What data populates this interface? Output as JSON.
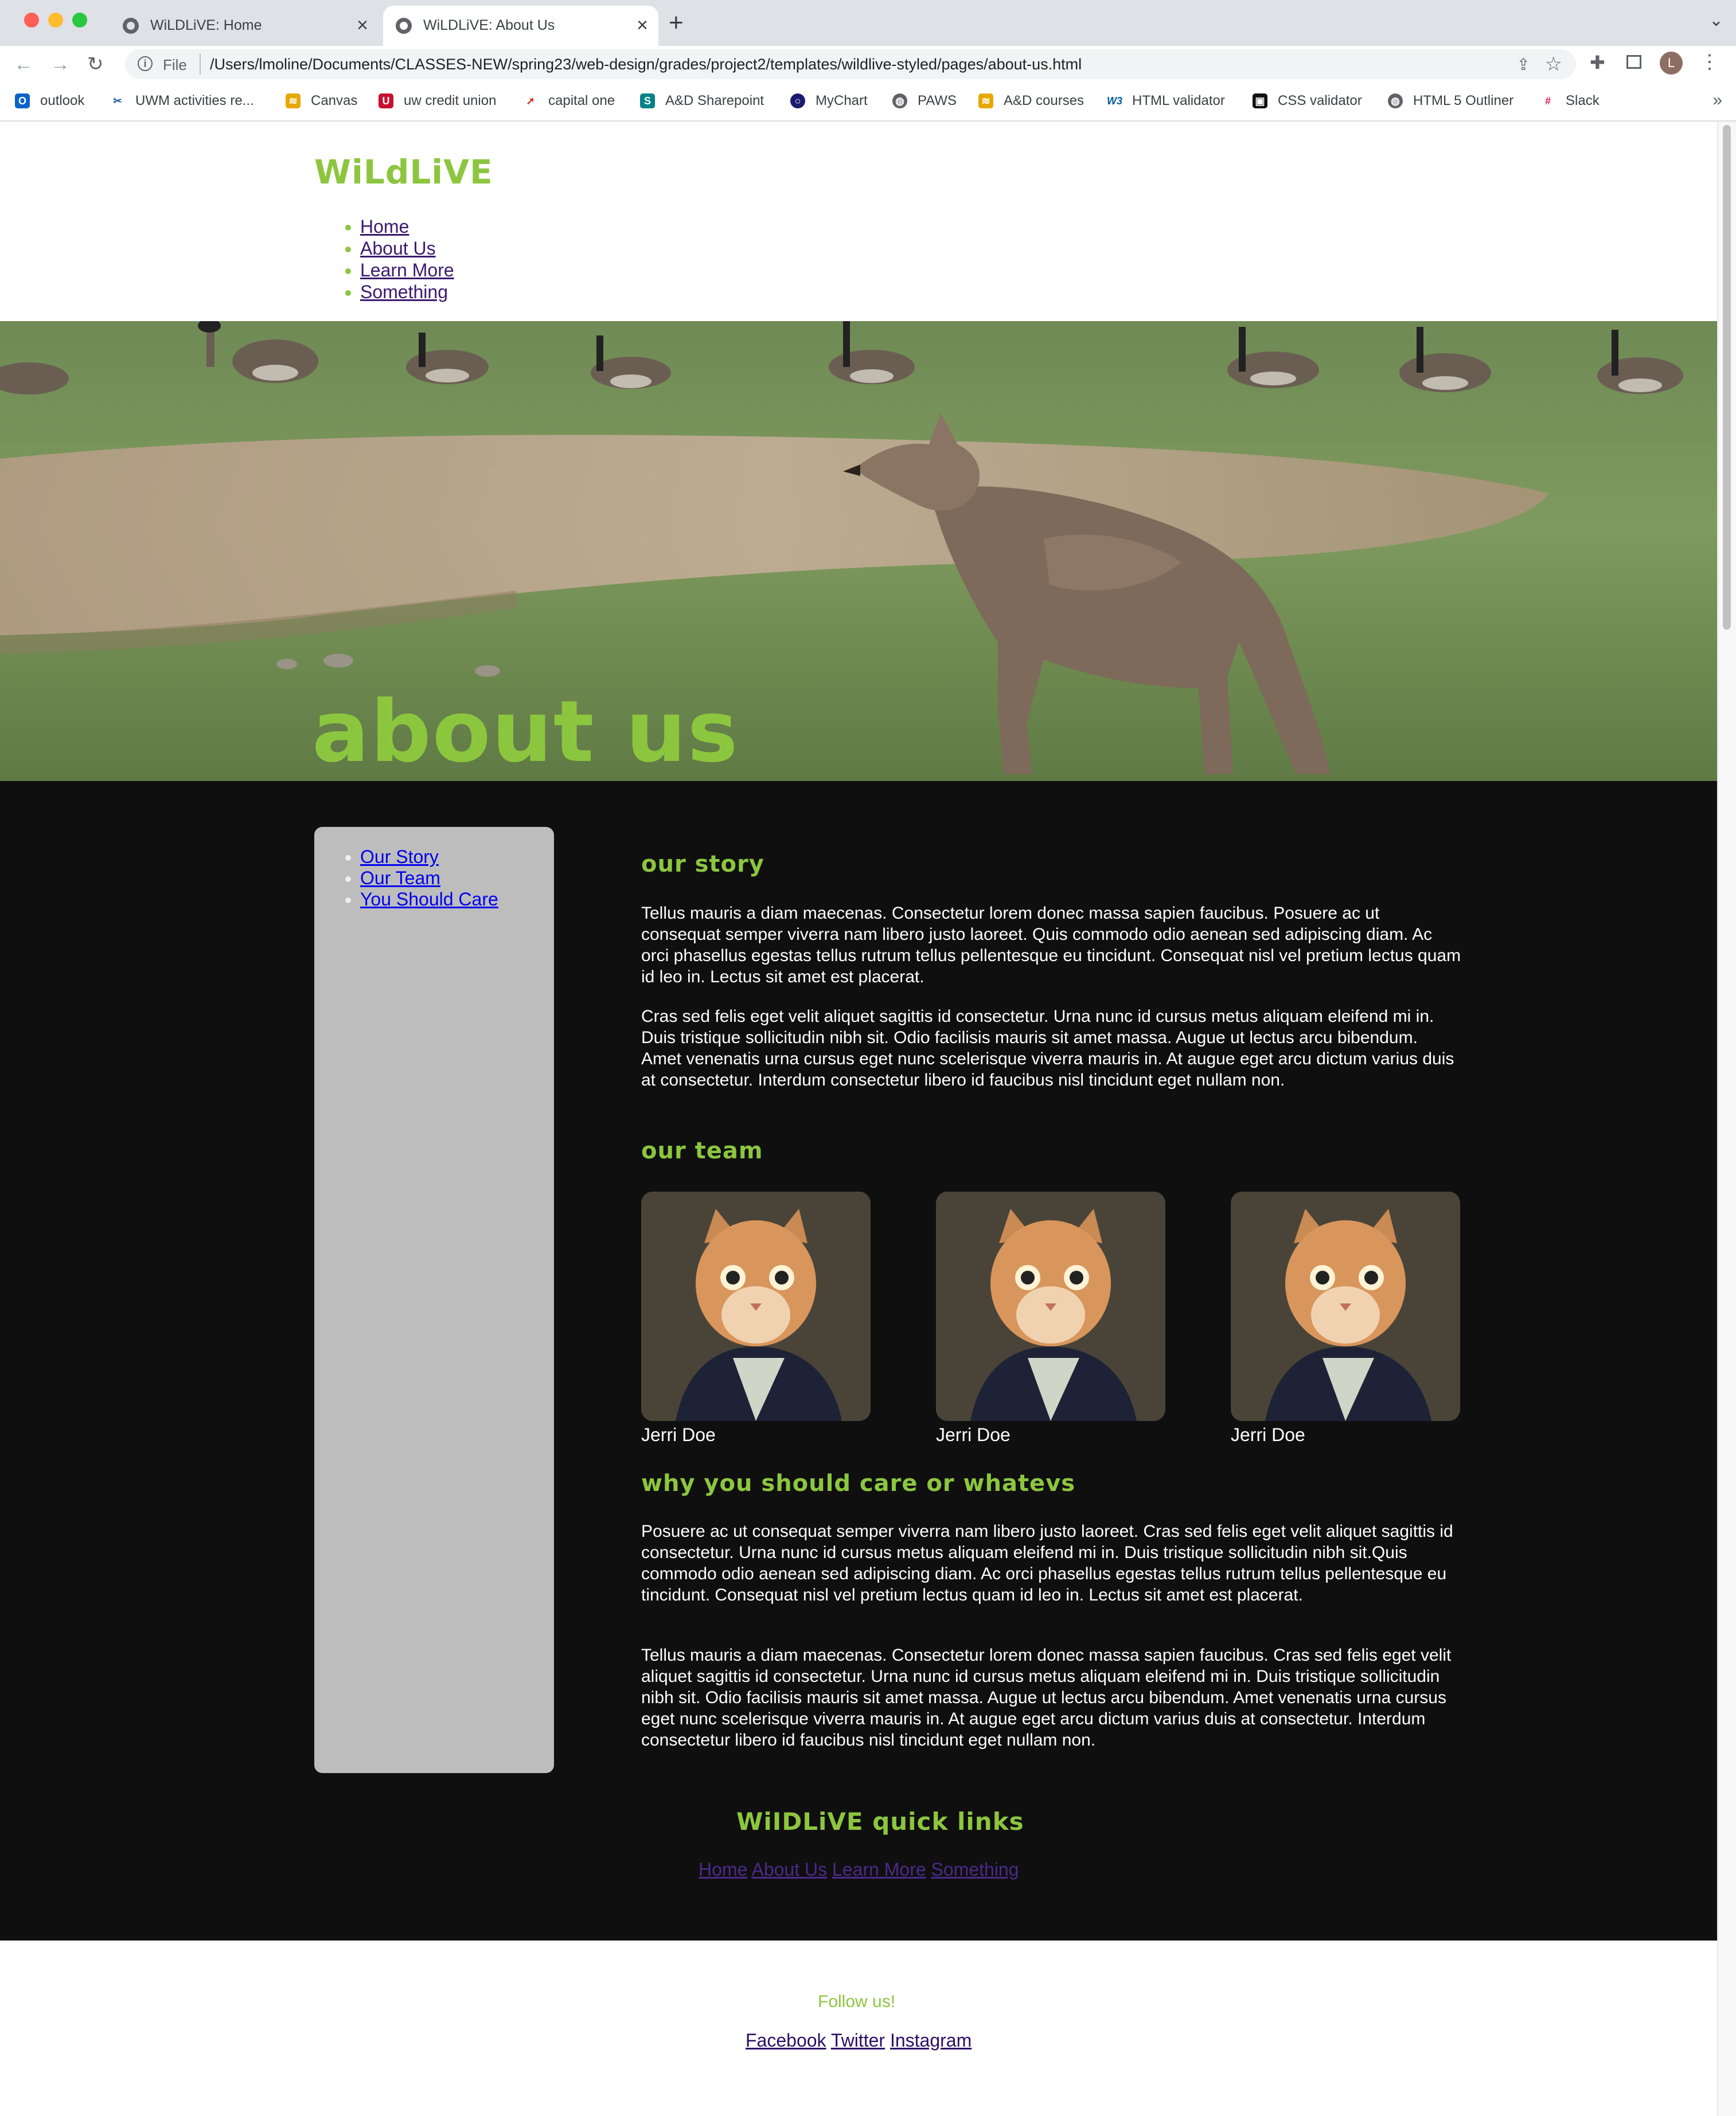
{
  "browser": {
    "tabs": [
      {
        "title": "WiLDLiVE: Home",
        "active": false
      },
      {
        "title": "WiLDLiVE: About Us",
        "active": true
      }
    ],
    "address": {
      "scheme": "File",
      "url": "/Users/lmoline/Documents/CLASSES-NEW/spring23/web-design/grades/project2/templates/wildlive-styled/pages/about-us.html"
    },
    "profile_initial": "L",
    "bookmarks": [
      {
        "label": "outlook",
        "icon": "outlook-icon",
        "color": "#0a64c8"
      },
      {
        "label": "UWM activities re...",
        "icon": "scissors-icon",
        "color": "#1a56a8"
      },
      {
        "label": "Canvas",
        "icon": "canvas-icon",
        "color": "#e6a800"
      },
      {
        "label": "uw credit union",
        "icon": "uwcu-icon",
        "color": "#c8102e"
      },
      {
        "label": "capital one",
        "icon": "swoosh-icon",
        "color": "#d22e1e"
      },
      {
        "label": "A&D Sharepoint",
        "icon": "sharepoint-icon",
        "color": "#038387"
      },
      {
        "label": "MyChart",
        "icon": "ring-icon",
        "color": "#1a1a6e"
      },
      {
        "label": "PAWS",
        "icon": "globe-icon",
        "color": "#5f6368"
      },
      {
        "label": "A&D courses",
        "icon": "uwm-icon",
        "color": "#e6a800"
      },
      {
        "label": "HTML validator",
        "icon": "w3-icon",
        "color": "#005a9c"
      },
      {
        "label": "CSS validator",
        "icon": "css-icon",
        "color": "#111111"
      },
      {
        "label": "HTML 5 Outliner",
        "icon": "globe-icon",
        "color": "#5f6368"
      },
      {
        "label": "Slack",
        "icon": "slack-icon",
        "color": "#4a154b"
      }
    ]
  },
  "site": {
    "logo": "WiLdLiVE",
    "nav": [
      "Home",
      "About Us",
      "Learn More",
      "Something"
    ],
    "hero_title": "about us",
    "subnav": [
      "Our Story",
      "Our Team",
      "You Should Care"
    ],
    "sections": {
      "story": {
        "heading": "our story",
        "p1": "Tellus mauris a diam maecenas. Consectetur lorem donec massa sapien faucibus. Posuere ac ut consequat semper viverra nam libero justo laoreet. Quis commodo odio aenean sed adipiscing diam. Ac orci phasellus egestas tellus rutrum tellus pellentesque eu tincidunt. Consequat nisl vel pretium lectus quam id leo in. Lectus sit amet est placerat.",
        "p2": "Cras sed felis eget velit aliquet sagittis id consectetur. Urna nunc id cursus metus aliquam eleifend mi in. Duis tristique sollicitudin nibh sit. Odio facilisis mauris sit amet massa. Augue ut lectus arcu bibendum. Amet venenatis urna cursus eget nunc scelerisque viverra mauris in. At augue eget arcu dictum varius duis at consectetur. Interdum consectetur libero id faucibus nisl tincidunt eget nullam non."
      },
      "team": {
        "heading": "our team",
        "members": [
          "Jerri Doe",
          "Jerri Doe",
          "Jerri Doe"
        ]
      },
      "care": {
        "heading": "why you should care or whatevs",
        "p1": "Posuere ac ut consequat semper viverra nam libero justo laoreet. Cras sed felis eget velit aliquet sagittis id consectetur. Urna nunc id cursus metus aliquam eleifend mi in. Duis tristique sollicitudin nibh sit.Quis commodo odio aenean sed adipiscing diam. Ac orci phasellus egestas tellus rutrum tellus pellentesque eu tincidunt. Consequat nisl vel pretium lectus quam id leo in. Lectus sit amet est placerat.",
        "p2": "Tellus mauris a diam maecenas. Consectetur lorem donec massa sapien faucibus. Cras sed felis eget velit aliquet sagittis id consectetur. Urna nunc id cursus metus aliquam eleifend mi in. Duis tristique sollicitudin nibh sit. Odio facilisis mauris sit amet massa. Augue ut lectus arcu bibendum. Amet venenatis urna cursus eget nunc scelerisque viverra mauris in. At augue eget arcu dictum varius duis at consectetur. Interdum consectetur libero id faucibus nisl tincidunt eget nullam non."
      }
    },
    "quick_links": {
      "heading": "WiIDLiVE quick links",
      "links": [
        "Home",
        "About Us",
        "Learn More",
        "Something"
      ]
    },
    "footer": {
      "follow": "Follow us!",
      "social": [
        "Facebook",
        "Twitter",
        "Instagram"
      ]
    },
    "colors": {
      "accent": "#8cc63f",
      "dark": "#0f0f0f",
      "sidebar": "#bdbdbd",
      "link_visited": "#3b1a6e",
      "link": "#0000ee"
    }
  }
}
